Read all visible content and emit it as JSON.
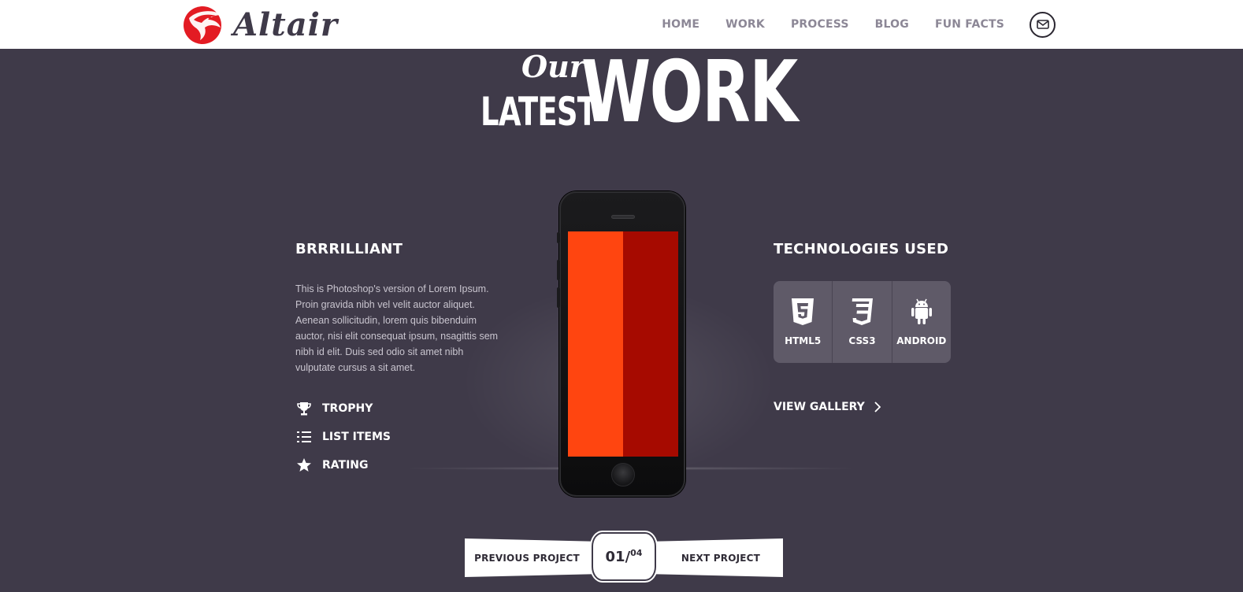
{
  "brand": {
    "name": "Altair",
    "accent": "#e31b23"
  },
  "nav": {
    "items": [
      "HOME",
      "WORK",
      "PROCESS",
      "BLOG",
      "FUN FACTS"
    ],
    "mail_icon": "envelope-icon"
  },
  "heading": {
    "our": "Our",
    "latest": "LATEST",
    "work": "WORK"
  },
  "project": {
    "title": "BRRRILLIANT",
    "description": "This is Photoshop's version of Lorem Ipsum. Proin gravida nibh vel velit auctor aliquet. Aenean sollicitudin, lorem quis bibenduim auctor, nisi elit consequat ipsum, nsagittis sem nibh id elit. Duis sed odio sit amet nibh vulputate cursus a sit amet.",
    "features": [
      {
        "icon": "trophy-icon",
        "label": "TROPHY"
      },
      {
        "icon": "list-icon",
        "label": "LIST ITEMS"
      },
      {
        "icon": "star-icon",
        "label": "RATING"
      }
    ]
  },
  "phone": {
    "screen_colors": [
      "#ff4510",
      "#a60a00"
    ]
  },
  "technologies": {
    "title": "TECHNOLOGIES USED",
    "items": [
      {
        "icon": "html5-icon",
        "label": "HTML5"
      },
      {
        "icon": "css3-icon",
        "label": "CSS3"
      },
      {
        "icon": "android-icon",
        "label": "ANDROID"
      }
    ],
    "gallery_label": "VIEW GALLERY"
  },
  "pager": {
    "prev_label": "PREVIOUS PROJECT",
    "next_label": "NEXT PROJECT",
    "current": "01/",
    "total": "04"
  },
  "colors": {
    "background": "#3f3a49",
    "header": "#ffffff",
    "tech_box": "#5f5a68"
  }
}
